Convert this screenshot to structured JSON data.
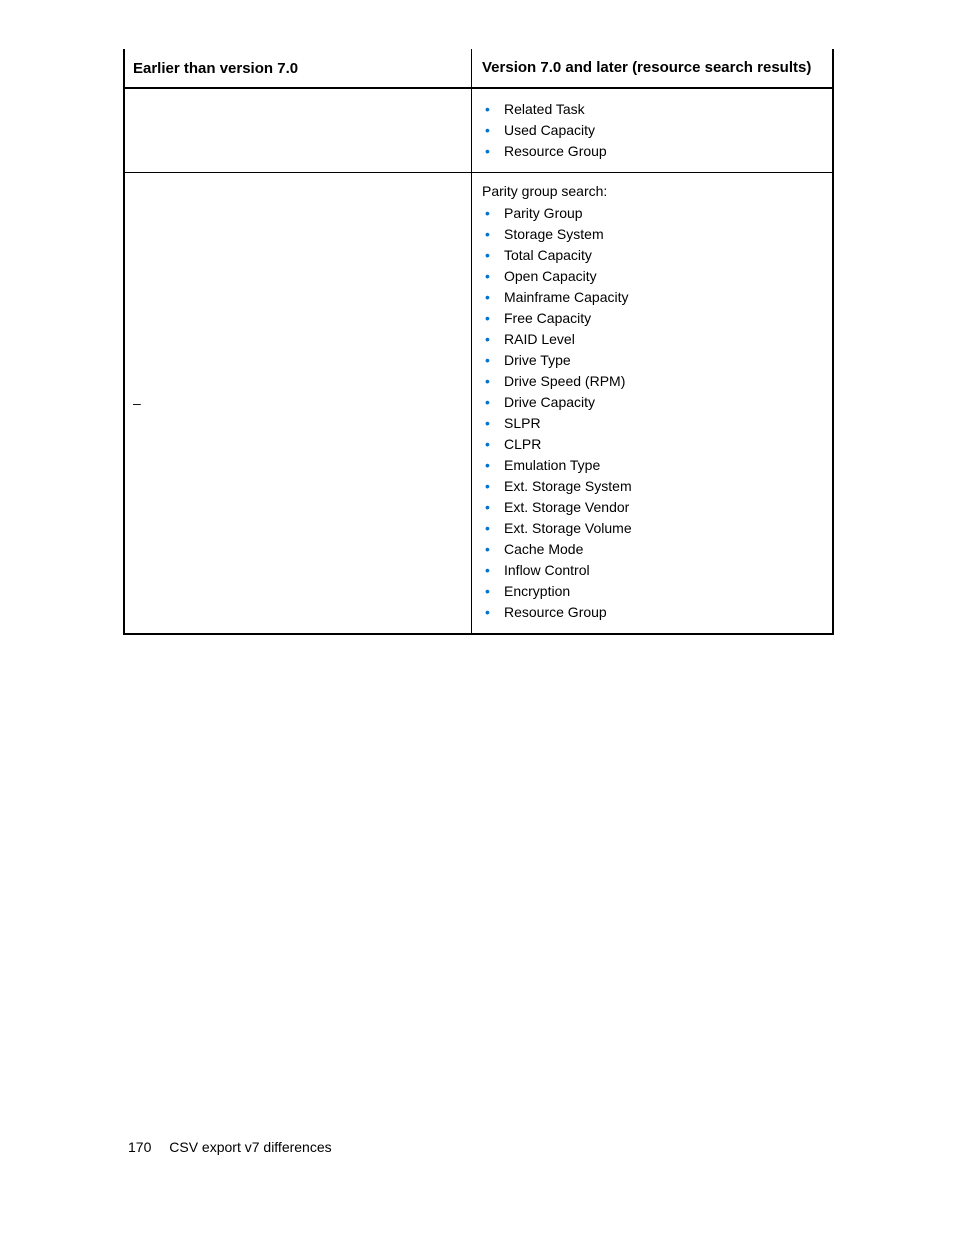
{
  "table": {
    "headers": {
      "left": "Earlier than version 7.0",
      "right": "Version 7.0 and later (resource search results)"
    },
    "rows": [
      {
        "left": "",
        "right_intro": "",
        "right_items": [
          "Related Task",
          "Used Capacity",
          "Resource Group"
        ]
      },
      {
        "left": "–",
        "right_intro": "Parity group search:",
        "right_items": [
          "Parity Group",
          "Storage System",
          "Total Capacity",
          "Open Capacity",
          "Mainframe Capacity",
          "Free Capacity",
          "RAID Level",
          "Drive Type",
          "Drive Speed (RPM)",
          "Drive Capacity",
          "SLPR",
          "CLPR",
          "Emulation Type",
          "Ext. Storage System",
          "Ext. Storage Vendor",
          "Ext. Storage Volume",
          "Cache Mode",
          "Inflow Control",
          "Encryption",
          "Resource Group"
        ]
      }
    ]
  },
  "footer": {
    "page_number": "170",
    "title": "CSV export v7 differences"
  }
}
